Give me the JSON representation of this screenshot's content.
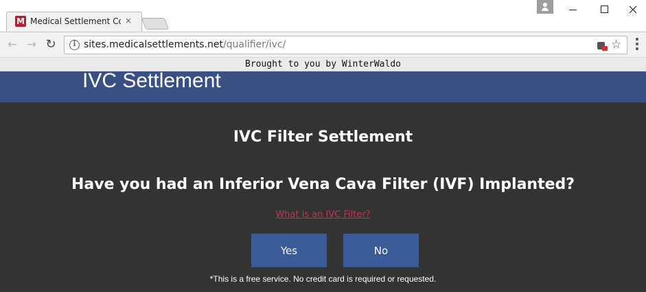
{
  "browser": {
    "tab": {
      "favicon_letter": "M",
      "title": "Medical Settlement Com",
      "close_glyph": "×"
    },
    "toolbar": {
      "back_glyph": "←",
      "forward_glyph": "→",
      "reload_glyph": "↻",
      "info_glyph": "i",
      "url_host": "sites.medicalsettlements.net",
      "url_path": "/qualifier/ivc/",
      "star_glyph": "☆"
    },
    "colors": {
      "favicon": "#b51f34",
      "header": "#3a5085",
      "button": "#3a5a98",
      "link": "#c0344f",
      "page_background": "#333333"
    }
  },
  "banner": {
    "text": "Brought to you by WinterWaldo"
  },
  "site": {
    "header_title": "IVC Settlement",
    "page_title": "IVC Filter Settlement",
    "question": "Have you had an Inferior Vena Cava Filter (IVF) Implanted?",
    "info_link": "What is an IVC Filter?",
    "yes_label": "Yes",
    "no_label": "No",
    "disclaimer": "*This is a free service. No credit card is required or requested."
  }
}
